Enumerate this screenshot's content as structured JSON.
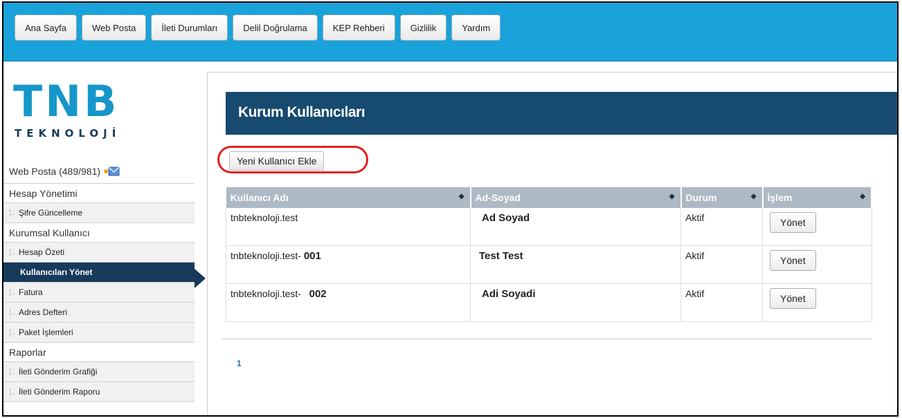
{
  "nav": [
    "Ana Sayfa",
    "Web Posta",
    "İleti Durumları",
    "Delil Doğrulama",
    "KEP Rehberi",
    "Gizlilik",
    "Yardım"
  ],
  "logo": {
    "word": "TNB",
    "sub": "TEKNOLOJİ"
  },
  "sidebar": {
    "webposta": "Web Posta (489/981)",
    "sections": [
      {
        "head": "Hesap Yönetimi",
        "items": [
          "Şifre Güncelleme"
        ]
      },
      {
        "head": "Kurumsal Kullanıcı",
        "items": [
          "Hesap Özeti",
          "Kullanıcıları Yönet",
          "Fatura",
          "Adres Defteri",
          "Paket İşlemleri"
        ]
      },
      {
        "head": "Raporlar",
        "items": [
          "İleti Gönderim Grafiği",
          "İleti Gönderim Raporu"
        ]
      }
    ]
  },
  "main": {
    "title": "Kurum Kullanıcıları",
    "add_label": "Yeni Kullanıcı Ekle",
    "columns": [
      "Kullanıcı Adı",
      "Ad-Soyad",
      "Durum",
      "İşlem"
    ],
    "rows": [
      {
        "user_prefix": "tnbteknoloji.test",
        "user_suffix": "",
        "name": "Ad Soyad",
        "status": "Aktif",
        "action": "Yönet"
      },
      {
        "user_prefix": "tnbteknoloji.test-",
        "user_suffix": "001",
        "name": "Test Test",
        "status": "Aktif",
        "action": "Yönet"
      },
      {
        "user_prefix": "tnbteknoloji.test-",
        "user_suffix": "002",
        "name": "Adi Soyadi",
        "status": "Aktif",
        "action": "Yönet"
      }
    ],
    "page": "1"
  },
  "colors": {
    "topbar": "#19a3da",
    "brand": "#1697c9",
    "title_bar": "#174a6f",
    "active": "#173a5b",
    "table_header": "#adb9c4",
    "highlight": "#e02020"
  }
}
